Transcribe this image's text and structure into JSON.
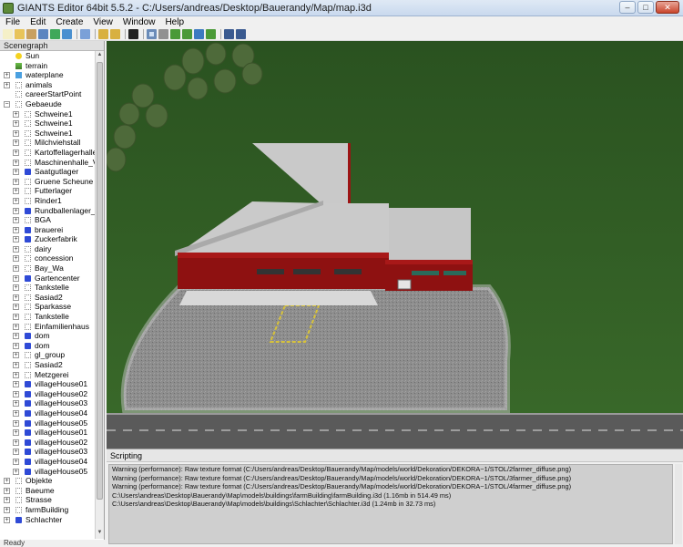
{
  "window": {
    "title": "GIANTS Editor 64bit 5.5.2 - C:/Users/andreas/Desktop/Bauerandy/Map/map.i3d",
    "minimize": "–",
    "maximize": "□",
    "close": "✕"
  },
  "menu": [
    "File",
    "Edit",
    "Create",
    "View",
    "Window",
    "Help"
  ],
  "toolbar": [
    {
      "name": "new-icon",
      "color": "#f5f0c8"
    },
    {
      "name": "open-icon",
      "color": "#e8c45a"
    },
    {
      "name": "edit-icon",
      "color": "#c8a060"
    },
    {
      "name": "save-icon",
      "color": "#5a84c0"
    },
    {
      "name": "save-all-icon",
      "color": "#3fa85a"
    },
    {
      "name": "export-icon",
      "color": "#4a90d0"
    },
    {
      "sep": true
    },
    {
      "name": "import-icon",
      "color": "#7aa0d8"
    },
    {
      "sep": true
    },
    {
      "name": "undo-icon",
      "color": "#d8b040"
    },
    {
      "name": "redo-icon",
      "color": "#d8b040"
    },
    {
      "sep": true
    },
    {
      "name": "play-icon",
      "color": "#222222"
    },
    {
      "sep": true
    },
    {
      "name": "select-icon",
      "color": "#6a8bb8",
      "pressed": true
    },
    {
      "name": "move-icon",
      "color": "#909090"
    },
    {
      "name": "terrain-sculpt-icon",
      "color": "#4a9a38"
    },
    {
      "name": "terrain-paint-icon",
      "color": "#4a9a38"
    },
    {
      "name": "foliage-paint-icon",
      "color": "#3c7ac0"
    },
    {
      "name": "decal-paint-icon",
      "color": "#4a9a38"
    },
    {
      "sep": true
    },
    {
      "name": "settings-icon",
      "color": "#3a5a90"
    },
    {
      "name": "camera-icon",
      "color": "#3a5a90"
    }
  ],
  "scenegraph": {
    "title": "Scenegraph",
    "items": [
      {
        "label": "Sun",
        "level": 1,
        "icon": "sun-icon",
        "exp": ""
      },
      {
        "label": "terrain",
        "level": 1,
        "icon": "terrain-icon",
        "exp": ""
      },
      {
        "label": "waterplane",
        "level": 1,
        "icon": "water-icon",
        "exp": "+"
      },
      {
        "label": "animals",
        "level": 1,
        "icon": "group-icon",
        "exp": "+"
      },
      {
        "label": "careerStartPoint",
        "level": 1,
        "icon": "group-icon",
        "exp": ""
      },
      {
        "label": "Gebaeude",
        "level": 1,
        "icon": "group-icon",
        "exp": "−"
      },
      {
        "label": "Schweine1",
        "level": 2,
        "icon": "group-icon",
        "exp": "+"
      },
      {
        "label": "Schweine1",
        "level": 2,
        "icon": "group-icon",
        "exp": "+"
      },
      {
        "label": "Schweine1",
        "level": 2,
        "icon": "group-icon",
        "exp": "+"
      },
      {
        "label": "Milchviehstall",
        "level": 2,
        "icon": "group-icon",
        "exp": "+"
      },
      {
        "label": "Kartoffellagerhalle",
        "level": 2,
        "icon": "group-icon",
        "exp": "+"
      },
      {
        "label": "Maschinenhalle_V2",
        "level": 2,
        "icon": "group-icon",
        "exp": "+"
      },
      {
        "label": "Saatgutlager",
        "level": 2,
        "icon": "mesh-icon",
        "exp": "+"
      },
      {
        "label": "Gruene Scheune",
        "level": 2,
        "icon": "group-icon",
        "exp": "+"
      },
      {
        "label": "Futterlager",
        "level": 2,
        "icon": "group-icon",
        "exp": "+"
      },
      {
        "label": "Rinder1",
        "level": 2,
        "icon": "group-icon",
        "exp": "+"
      },
      {
        "label": "Rundballenlager_by",
        "level": 2,
        "icon": "mesh-icon",
        "exp": "+"
      },
      {
        "label": "BGA",
        "level": 2,
        "icon": "group-icon",
        "exp": "+"
      },
      {
        "label": "brauerei",
        "level": 2,
        "icon": "mesh-icon",
        "exp": "+"
      },
      {
        "label": "Zuckerfabrik",
        "level": 2,
        "icon": "mesh-icon",
        "exp": "+"
      },
      {
        "label": "dairy",
        "level": 2,
        "icon": "group-icon",
        "exp": "+"
      },
      {
        "label": "concession",
        "level": 2,
        "icon": "group-icon",
        "exp": "+"
      },
      {
        "label": "Bay_Wa",
        "level": 2,
        "icon": "group-icon",
        "exp": "+"
      },
      {
        "label": "Gartencenter",
        "level": 2,
        "icon": "mesh-icon",
        "exp": "+"
      },
      {
        "label": "Tankstelle",
        "level": 2,
        "icon": "group-icon",
        "exp": "+"
      },
      {
        "label": "Sasiad2",
        "level": 2,
        "icon": "group-icon",
        "exp": "+"
      },
      {
        "label": "Sparkasse",
        "level": 2,
        "icon": "group-icon",
        "exp": "+"
      },
      {
        "label": "Tankstelle",
        "level": 2,
        "icon": "group-icon",
        "exp": "+"
      },
      {
        "label": "Einfamilienhaus",
        "level": 2,
        "icon": "group-icon",
        "exp": "+"
      },
      {
        "label": "dom",
        "level": 2,
        "icon": "mesh-icon",
        "exp": "+"
      },
      {
        "label": "dom",
        "level": 2,
        "icon": "mesh-icon",
        "exp": "+"
      },
      {
        "label": "gl_group",
        "level": 2,
        "icon": "group-icon",
        "exp": "+"
      },
      {
        "label": "Sasiad2",
        "level": 2,
        "icon": "group-icon",
        "exp": "+"
      },
      {
        "label": "Metzgerei",
        "level": 2,
        "icon": "group-icon",
        "exp": "+"
      },
      {
        "label": "villageHouse01",
        "level": 2,
        "icon": "mesh-icon",
        "exp": "+"
      },
      {
        "label": "villageHouse02",
        "level": 2,
        "icon": "mesh-icon",
        "exp": "+"
      },
      {
        "label": "villageHouse03",
        "level": 2,
        "icon": "mesh-icon",
        "exp": "+"
      },
      {
        "label": "villageHouse04",
        "level": 2,
        "icon": "mesh-icon",
        "exp": "+"
      },
      {
        "label": "villageHouse05",
        "level": 2,
        "icon": "mesh-icon",
        "exp": "+"
      },
      {
        "label": "villageHouse01",
        "level": 2,
        "icon": "mesh-icon",
        "exp": "+"
      },
      {
        "label": "villageHouse02",
        "level": 2,
        "icon": "mesh-icon",
        "exp": "+"
      },
      {
        "label": "villageHouse03",
        "level": 2,
        "icon": "mesh-icon",
        "exp": "+"
      },
      {
        "label": "villageHouse04",
        "level": 2,
        "icon": "mesh-icon",
        "exp": "+"
      },
      {
        "label": "villageHouse05",
        "level": 2,
        "icon": "mesh-icon",
        "exp": "+"
      },
      {
        "label": "Objekte",
        "level": 1,
        "icon": "group-icon",
        "exp": "+"
      },
      {
        "label": "Baeume",
        "level": 1,
        "icon": "group-icon",
        "exp": "+"
      },
      {
        "label": "Strasse",
        "level": 1,
        "icon": "group-icon",
        "exp": "+"
      },
      {
        "label": "farmBuilding",
        "level": 1,
        "icon": "group-icon",
        "exp": "+"
      },
      {
        "label": "Schlachter",
        "level": 1,
        "icon": "mesh-icon",
        "exp": "+"
      }
    ]
  },
  "status": "Ready",
  "scripting": {
    "title": "Scripting",
    "lines": [
      "Warning (performance): Raw texture format (C:/Users/andreas/Desktop/Bauerandy/Map/models/world/Dekoration/DEKORA~1/STOL/2farmer_diffuse.png)",
      "Warning (performance): Raw texture format (C:/Users/andreas/Desktop/Bauerandy/Map/models/world/Dekoration/DEKORA~1/STOL/3farmer_diffuse.png)",
      "Warning (performance): Raw texture format (C:/Users/andreas/Desktop/Bauerandy/Map/models/world/Dekoration/DEKORA~1/STOL/4farmer_diffuse.png)",
      "C:\\Users\\andreas\\Desktop\\Bauerandy\\Map\\models\\buildings\\farmBuilding\\farmBuilding.i3d (1.16mb in 514.49 ms)",
      "C:\\Users\\andreas\\Desktop\\Bauerandy\\Map\\models\\buildings\\Schlachter\\Schlachter.i3d (1.24mb in 32.73 ms)"
    ]
  },
  "colors": {
    "grass": "#2f5a22",
    "building_wall": "#9c1414",
    "roof": "#c8c8c8",
    "gravel": "#8a8a8a",
    "road": "#5a5a5a"
  }
}
